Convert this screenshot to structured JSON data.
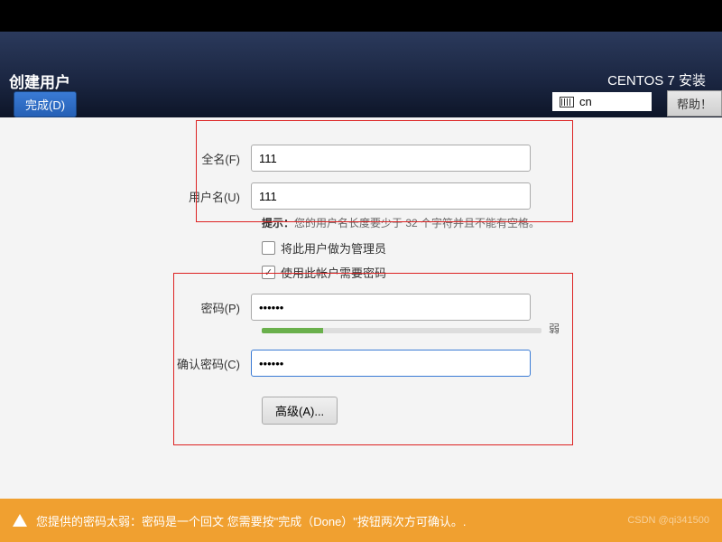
{
  "header": {
    "title_left": "创建用户",
    "title_right": "CENTOS 7 安装",
    "done_button": "完成(D)",
    "help_button": "帮助！",
    "lang": "cn"
  },
  "form": {
    "fullname_label": "全名(F)",
    "fullname_value": "111",
    "username_label": "用户名(U)",
    "username_value": "111",
    "hint_prefix": "提示：",
    "hint_text": "您的用户名长度要少于 32 个字符并且不能有空格。",
    "admin_checkbox": "将此用户做为管理员",
    "require_password_checkbox": "使用此帐户需要密码",
    "password_label": "密码(P)",
    "password_value": "••••••",
    "strength_text": "弱",
    "confirm_label": "确认密码(C)",
    "confirm_value": "••••••",
    "advanced_button": "高级(A)..."
  },
  "warning": {
    "message": "您提供的密码太弱：密码是一个回文 您需要按\"完成（Done）\"按钮两次方可确认。.",
    "watermark": "CSDN @qi341500"
  }
}
